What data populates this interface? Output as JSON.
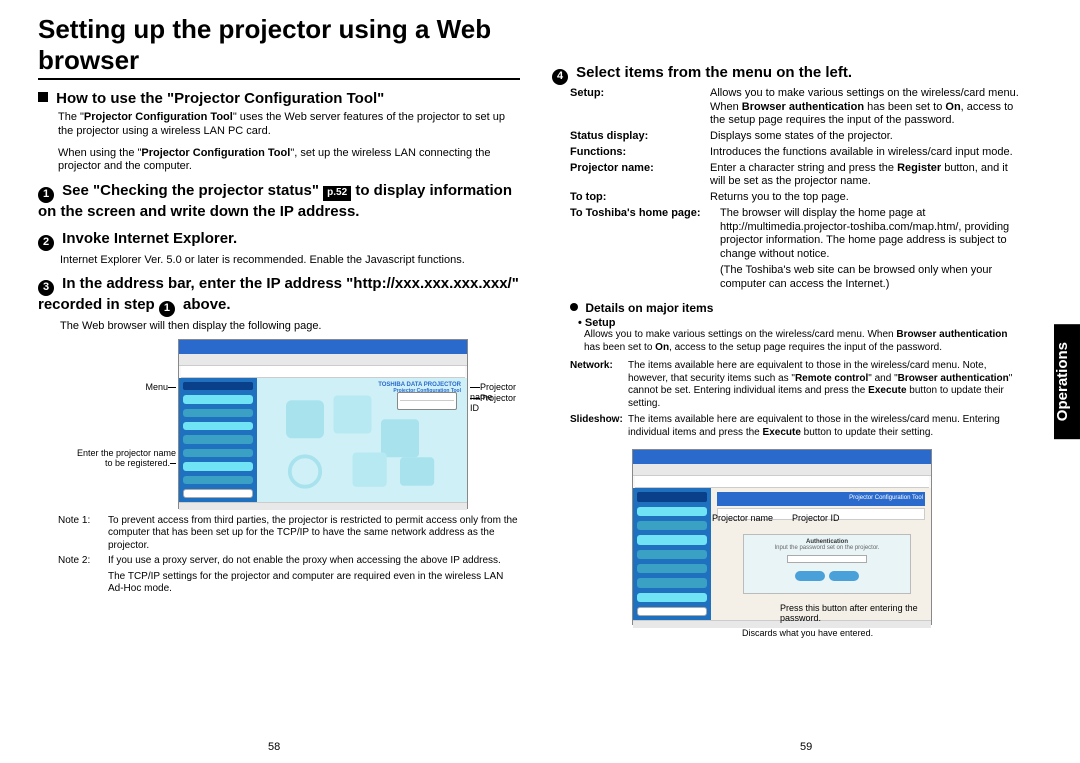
{
  "sidebar_tab": "Operations",
  "title": "Setting up the projector using a Web browser",
  "left": {
    "how_heading": "How to use the \"Projector Configuration Tool\"",
    "how_p1_a": "The \"",
    "how_p1_b": "Projector Configuration Tool",
    "how_p1_c": "\" uses the Web server features of the projector to set up the projector using a wireless LAN PC card.",
    "how_p2_a": "When using the \"",
    "how_p2_b": "Projector Configuration Tool",
    "how_p2_c": "\", set up the wireless LAN connecting the projector and the computer.",
    "step1_a": "See \"Checking the projector status\"",
    "step1_pref": "p.52",
    "step1_b": "to display information on the screen and write down the IP address.",
    "step2": "Invoke Internet Explorer.",
    "step2_body": "Internet Explorer Ver. 5.0 or later is recommended. Enable the Javascript functions.",
    "step3_a": "In the address bar, enter the IP address \"http://xxx.xxx.xxx.xxx/\" recorded in step",
    "step3_b": "above.",
    "step3_body": "The Web browser will then display the following page.",
    "shot1_callouts": {
      "menu": "Menu",
      "enter": "Enter the projector name to be registered.",
      "conf_tool": "Projector Configuration Tool",
      "projname": "Projector name",
      "projid": "Projector ID",
      "brand": "TOSHIBA",
      "headline": "TOSHIBA DATA PROJECTOR"
    },
    "notes": [
      {
        "lab": "Note 1:",
        "txt": "To prevent access from third parties, the projector is restricted to permit access only from the computer that has been set up for the TCP/IP to have the same network address as the projector."
      },
      {
        "lab": "Note 2:",
        "txt": "If you use a proxy server, do not enable the proxy when accessing the above IP address."
      },
      {
        "lab": "",
        "txt": "The TCP/IP settings for the projector and computer are required even in the wireless LAN Ad-Hoc mode."
      }
    ]
  },
  "right": {
    "step4": "Select items from the menu on the left.",
    "defs": [
      {
        "k": "Setup:",
        "v_a": "Allows you to make various settings on the wireless/card menu. When ",
        "v_b": "Browser authentication",
        "v_c": " has been set to ",
        "v_d": "On",
        "v_e": ", access to the setup page requires the input of the password."
      },
      {
        "k": "Status display:",
        "v": "Displays some states of the projector."
      },
      {
        "k": "Functions:",
        "v": "Introduces the functions available in wireless/card input mode."
      },
      {
        "k": "Projector name:",
        "v_a": "Enter a character string and press the ",
        "v_b": "Register",
        "v_c": " button, and it will be set as the projector name."
      },
      {
        "k": "To top:",
        "v": "Returns you to the top page."
      },
      {
        "k": "To Toshiba's home page:",
        "v": "The browser will display the home page at http://multimedia.projector-toshiba.com/map.htm/, providing projector information. The home page address is subject to change without notice."
      },
      {
        "k": "",
        "v": "(The Toshiba's web site can be browsed only when your computer can access the Internet.)"
      }
    ],
    "details_heading": "Details on major items",
    "setup_bullet": "• Setup",
    "setup_text_a": "Allows you to make various settings on the wireless/card menu. When ",
    "setup_text_b": "Browser authentication",
    "setup_text_c": " has been set to ",
    "setup_text_d": "On",
    "setup_text_e": ", access to the setup page requires the input of the password.",
    "detail_items": [
      {
        "k": "Network:",
        "v_a": "The items available here are equivalent to those in the wireless/card menu. Note, however, that security items such as \"",
        "v_b": "Remote control",
        "v_c": "\" and \"",
        "v_d": "Browser authentication",
        "v_e": "\" cannot be set. Entering individual items and press the ",
        "v_f": "Execute",
        "v_g": " button to update their setting."
      },
      {
        "k": "Slideshow:",
        "v_a": "The items available here are equivalent to those in the wireless/card menu. Entering individual items and press the ",
        "v_b": "Execute",
        "v_c": " button to update their setting."
      }
    ],
    "shot2_callouts": {
      "projname": "Projector name",
      "projid": "Projector ID",
      "press": "Press this button after entering the password.",
      "discard": "Discards what you have entered.",
      "auth_head": "Authentication",
      "auth_msg": "Input the password set on the projector.",
      "conf_tool": "Projector Configuration Tool"
    }
  },
  "page_left": "58",
  "page_right": "59"
}
